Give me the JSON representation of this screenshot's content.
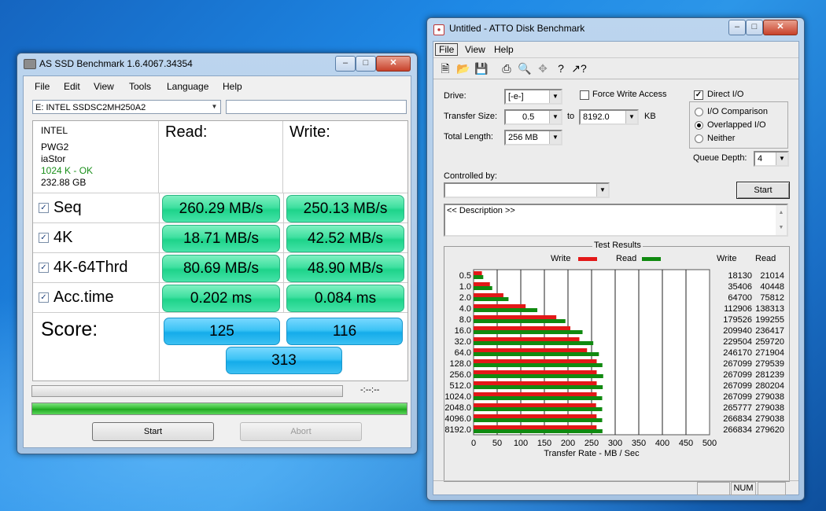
{
  "asssd": {
    "title": "AS SSD Benchmark 1.6.4067.34354",
    "menu": [
      "File",
      "Edit",
      "View",
      "Tools",
      "Language",
      "Help"
    ],
    "drive_select": "E: INTEL SSDSC2MH250A2",
    "drive_info": [
      "INTEL",
      "PWG2",
      "iaStor",
      "1024 K - OK",
      "232.88 GB"
    ],
    "ok_color": "#1a8f1a",
    "read_header": "Read:",
    "write_header": "Write:",
    "rows": [
      {
        "label": "Seq",
        "checked": true,
        "read": "260.29 MB/s",
        "write": "250.13 MB/s"
      },
      {
        "label": "4K",
        "checked": true,
        "read": "18.71 MB/s",
        "write": "42.52 MB/s"
      },
      {
        "label": "4K-64Thrd",
        "checked": true,
        "read": "80.69 MB/s",
        "write": "48.90 MB/s"
      },
      {
        "label": "Acc.time",
        "checked": true,
        "read": "0.202 ms",
        "write": "0.084 ms"
      }
    ],
    "score_label": "Score:",
    "score_read": "125",
    "score_write": "116",
    "score_total": "313",
    "time_display": "-:--:--",
    "progress_total": 1.0,
    "start_label": "Start",
    "abort_label": "Abort"
  },
  "atto": {
    "title": "Untitled - ATTO Disk Benchmark",
    "menu": [
      "File",
      "View",
      "Help"
    ],
    "toolbar_icons": [
      "new-icon",
      "open-icon",
      "save-icon",
      "print-icon",
      "print-preview-icon",
      "move-icon",
      "help-icon",
      "context-help-icon"
    ],
    "drive_label": "Drive:",
    "drive_value": "[-e-]",
    "transfer_size_label": "Transfer Size:",
    "transfer_from": "0.5",
    "transfer_to_label": "to",
    "transfer_to": "8192.0",
    "transfer_unit": "KB",
    "total_length_label": "Total Length:",
    "total_length": "256 MB",
    "force_write_label": "Force Write Access",
    "force_write_checked": false,
    "direct_io_label": "Direct I/O",
    "direct_io_checked": true,
    "io_options": [
      {
        "label": "I/O Comparison",
        "selected": false
      },
      {
        "label": "Overlapped I/O",
        "selected": true
      },
      {
        "label": "Neither",
        "selected": false
      }
    ],
    "queue_depth_label": "Queue Depth:",
    "queue_depth": "4",
    "controlled_by_label": "Controlled by:",
    "controlled_by_value": "",
    "start_label": "Start",
    "description": "<< Description >>",
    "results_title": "Test Results",
    "legend_write": "Write",
    "legend_read": "Read",
    "col_write": "Write",
    "col_read": "Read",
    "status_num": "NUM",
    "colors": {
      "write": "#e31818",
      "read": "#108a10"
    }
  },
  "chart_data": {
    "type": "bar",
    "title": "Test Results",
    "xlabel": "Transfer Rate - MB / Sec",
    "ylabel": "",
    "xlim": [
      0,
      500
    ],
    "xticks": [
      "0",
      "50",
      "100",
      "150",
      "200",
      "250",
      "300",
      "350",
      "400",
      "450",
      "500"
    ],
    "categories": [
      "0.5",
      "1.0",
      "2.0",
      "4.0",
      "8.0",
      "16.0",
      "32.0",
      "64.0",
      "128.0",
      "256.0",
      "512.0",
      "1024.0",
      "2048.0",
      "4096.0",
      "8192.0"
    ],
    "series": [
      {
        "name": "Write",
        "values": [
          18130,
          35406,
          64700,
          112906,
          179526,
          209940,
          229504,
          246170,
          267099,
          267099,
          267099,
          267099,
          265777,
          266834,
          266834
        ]
      },
      {
        "name": "Read",
        "values": [
          21014,
          40448,
          75812,
          138313,
          199255,
          236417,
          259720,
          271904,
          279539,
          281239,
          280204,
          279038,
          279038,
          279038,
          279620
        ]
      }
    ],
    "grid": true,
    "legend": "top"
  }
}
